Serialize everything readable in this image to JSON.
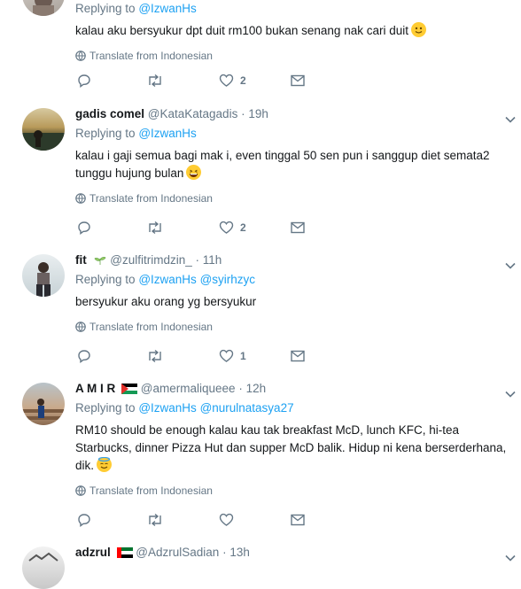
{
  "tweets": [
    {
      "name": "",
      "handle": "",
      "time": "",
      "replying_label": "Replying to",
      "replying_to": [
        "@IzwanHs"
      ],
      "text": "kalau aku bersyukur dpt duit rm100 bukan senang nak cari duit",
      "emoji": "slightly-smiling-face",
      "translate": "Translate from Indonesian",
      "reply_count": "",
      "retweet_count": "",
      "like_count": "2"
    },
    {
      "name": "gadis comel",
      "handle": "@KataKatagadis",
      "time": "19h",
      "replying_label": "Replying to",
      "replying_to": [
        "@IzwanHs"
      ],
      "text": "kalau i gaji semua bagi mak i, even tinggal 50 sen pun i sanggup diet semata2 tunggu hujung bulan",
      "emoji": "grinning-squinting-face",
      "translate": "Translate from Indonesian",
      "reply_count": "",
      "retweet_count": "",
      "like_count": "2"
    },
    {
      "name": "fit",
      "handle": "@zulfitrimdzin_",
      "time": "11h",
      "name_emoji": "herb",
      "replying_label": "Replying to",
      "replying_to": [
        "@IzwanHs",
        "@syirhzyc"
      ],
      "text": "bersyukur aku orang yg bersyukur",
      "translate": "Translate from Indonesian",
      "reply_count": "",
      "retweet_count": "",
      "like_count": "1"
    },
    {
      "name": "A M I R",
      "handle": "@amermaliqueee",
      "time": "12h",
      "name_emoji": "palestine-flag",
      "replying_label": "Replying to",
      "replying_to": [
        "@IzwanHs",
        "@nurulnatasya27"
      ],
      "text": "RM10 should be enough kalau kau tak breakfast McD, lunch KFC, hi-tea Starbucks, dinner Pizza Hut dan supper McD balik. Hidup ni kena berserderhana, dik.",
      "emoji": "smiling-face-with-halo",
      "translate": "Translate from Indonesian",
      "reply_count": "",
      "retweet_count": "",
      "like_count": ""
    },
    {
      "name": "adzrul",
      "handle": "@AdzrulSadian",
      "time": "13h",
      "name_emoji": "uae-flag"
    }
  ],
  "separator": "·",
  "colors": {
    "accent": "#1da1f2",
    "muted": "#657786",
    "text": "#14171a",
    "divider": "#e6ecf0"
  }
}
